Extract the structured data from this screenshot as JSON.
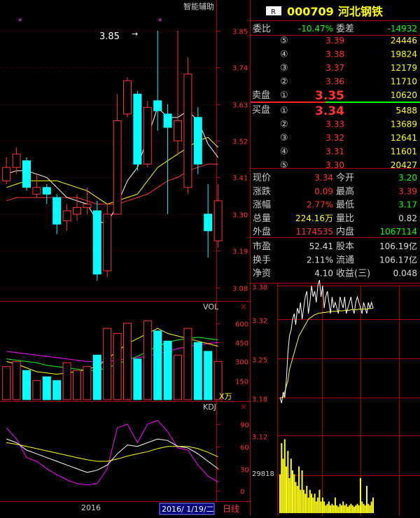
{
  "app": {
    "assist_label": "智能辅助",
    "star_marker": "*"
  },
  "stock": {
    "r_badge": "R",
    "code": "000709",
    "name": "河北钢铁"
  },
  "kline": {
    "annotation_high": "3.85",
    "price_ticks": [
      "3.85",
      "3.74",
      "3.63",
      "3.52",
      "3.41",
      "3.30",
      "3.19",
      "3.08"
    ],
    "candles": [
      {
        "o": 3.4,
        "c": 3.44,
        "h": 3.47,
        "l": 3.39
      },
      {
        "o": 3.44,
        "c": 3.48,
        "h": 3.5,
        "l": 3.42
      },
      {
        "o": 3.46,
        "c": 3.38,
        "h": 3.47,
        "l": 3.37
      },
      {
        "o": 3.36,
        "c": 3.38,
        "h": 3.42,
        "l": 3.35
      },
      {
        "o": 3.38,
        "c": 3.36,
        "h": 3.39,
        "l": 3.33
      },
      {
        "o": 3.35,
        "c": 3.27,
        "h": 3.36,
        "l": 3.24
      },
      {
        "o": 3.28,
        "c": 3.31,
        "h": 3.33,
        "l": 3.25
      },
      {
        "o": 3.3,
        "c": 3.32,
        "h": 3.36,
        "l": 3.28
      },
      {
        "o": 3.32,
        "c": 3.33,
        "h": 3.38,
        "l": 3.3
      },
      {
        "o": 3.31,
        "c": 3.12,
        "h": 3.34,
        "l": 3.1
      },
      {
        "o": 3.13,
        "c": 3.3,
        "h": 3.33,
        "l": 3.11
      },
      {
        "o": 3.3,
        "c": 3.58,
        "h": 3.66,
        "l": 3.3
      },
      {
        "o": 3.6,
        "c": 3.7,
        "h": 3.71,
        "l": 3.59
      },
      {
        "o": 3.66,
        "c": 3.45,
        "h": 3.67,
        "l": 3.43
      },
      {
        "o": 3.45,
        "c": 3.62,
        "h": 3.64,
        "l": 3.44
      },
      {
        "o": 3.64,
        "c": 3.61,
        "h": 3.85,
        "l": 3.55
      },
      {
        "o": 3.6,
        "c": 3.56,
        "h": 3.63,
        "l": 3.3
      },
      {
        "o": 3.52,
        "c": 3.58,
        "h": 3.85,
        "l": 3.48
      },
      {
        "o": 3.38,
        "c": 3.72,
        "h": 3.77,
        "l": 3.36
      },
      {
        "o": 3.59,
        "c": 3.45,
        "h": 3.62,
        "l": 3.42
      },
      {
        "o": 3.3,
        "c": 3.25,
        "h": 3.39,
        "l": 3.17
      },
      {
        "o": 3.22,
        "c": 3.34,
        "h": 3.39,
        "l": 3.2
      }
    ],
    "ma5": [
      3.42,
      3.43,
      3.43,
      3.42,
      3.41,
      3.38,
      3.35,
      3.34,
      3.33,
      3.28,
      3.27,
      3.33,
      3.4,
      3.44,
      3.53,
      3.62,
      3.59,
      3.59,
      3.61,
      3.58,
      3.51,
      3.47
    ],
    "ma10": [
      3.38,
      3.39,
      3.4,
      3.4,
      3.4,
      3.4,
      3.39,
      3.38,
      3.37,
      3.35,
      3.33,
      3.34,
      3.35,
      3.36,
      3.4,
      3.44,
      3.46,
      3.48,
      3.5,
      3.52,
      3.53,
      3.5
    ],
    "ma20": [
      3.34,
      3.35,
      3.35,
      3.35,
      3.35,
      3.35,
      3.35,
      3.35,
      3.34,
      3.33,
      3.33,
      3.33,
      3.34,
      3.35,
      3.36,
      3.38,
      3.4,
      3.41,
      3.43,
      3.44,
      3.45,
      3.45
    ],
    "colors": {
      "up": "#ff3232",
      "down": "#00ffff",
      "ma5": "#ffffff",
      "ma10": "#ffff00",
      "ma20": "#ff00ff"
    }
  },
  "vol": {
    "label": "VOL",
    "unit_label": "X万",
    "ticks": [
      "600",
      "450",
      "300",
      "150"
    ],
    "bars": [
      260,
      300,
      230,
      150,
      180,
      150,
      290,
      230,
      260,
      350,
      560,
      520,
      600,
      320,
      620,
      540,
      460,
      350,
      560,
      450,
      380,
      300
    ],
    "ma5": [
      300,
      280,
      250,
      220,
      210,
      200,
      210,
      220,
      240,
      260,
      320,
      380,
      440,
      480,
      520,
      560,
      520,
      500,
      480,
      460,
      440,
      420
    ],
    "ma10": [
      320,
      310,
      300,
      290,
      270,
      260,
      250,
      240,
      230,
      230,
      250,
      280,
      310,
      340,
      380,
      420,
      450,
      470,
      480,
      490,
      480,
      470
    ],
    "ma20": [
      380,
      370,
      360,
      350,
      340,
      330,
      320,
      310,
      300,
      300,
      300,
      310,
      320,
      330,
      340,
      360,
      380,
      400,
      420,
      430,
      440,
      450
    ]
  },
  "kdj": {
    "label": "KDJ",
    "ticks": [
      "90",
      "60",
      "30",
      "0"
    ],
    "k": [
      70,
      65,
      55,
      50,
      45,
      40,
      35,
      30,
      25,
      28,
      35,
      50,
      62,
      60,
      65,
      70,
      68,
      60,
      58,
      50,
      40,
      30
    ],
    "d": [
      65,
      63,
      60,
      57,
      54,
      51,
      48,
      45,
      42,
      40,
      40,
      43,
      47,
      50,
      53,
      57,
      60,
      60,
      60,
      57,
      52,
      46
    ],
    "j": [
      85,
      70,
      45,
      40,
      30,
      22,
      15,
      10,
      8,
      10,
      30,
      85,
      90,
      65,
      90,
      95,
      80,
      58,
      55,
      35,
      20,
      12
    ]
  },
  "timeline": {
    "year": "2016",
    "date": "2016/ 1/19/二",
    "period": "日线"
  },
  "quote": {
    "weibi_label": "委比",
    "weibi_value": "-10.47%",
    "weicha_label": "委差",
    "weicha_value": "-14932",
    "sell_label": "卖盘",
    "buy_label": "买盘",
    "sells": [
      {
        "idx": "⑤",
        "price": "3.39",
        "vol": "24446"
      },
      {
        "idx": "④",
        "price": "3.38",
        "vol": "19824"
      },
      {
        "idx": "③",
        "price": "3.37",
        "vol": "12179"
      },
      {
        "idx": "②",
        "price": "3.36",
        "vol": "11710"
      },
      {
        "idx": "①",
        "price": "3.35",
        "vol": "10620"
      }
    ],
    "buys": [
      {
        "idx": "①",
        "price": "3.34",
        "vol": "5488"
      },
      {
        "idx": "②",
        "price": "3.33",
        "vol": "13689"
      },
      {
        "idx": "③",
        "price": "3.32",
        "vol": "12641"
      },
      {
        "idx": "④",
        "price": "3.31",
        "vol": "11601"
      },
      {
        "idx": "⑤",
        "price": "3.30",
        "vol": "20427"
      }
    ],
    "stats": [
      {
        "l1": "现价",
        "v1": "3.34",
        "c1": "#ff3232",
        "l2": "今开",
        "v2": "3.20",
        "c2": "#00ff00"
      },
      {
        "l1": "涨跌",
        "v1": "0.09",
        "c1": "#ff3232",
        "l2": "最高",
        "v2": "3.39",
        "c2": "#ff3232"
      },
      {
        "l1": "涨幅",
        "v1": "2.77%",
        "c1": "#ff3232",
        "l2": "最低",
        "v2": "3.17",
        "c2": "#00ff00"
      },
      {
        "l1": "总量",
        "v1": "224.16万",
        "c1": "#ffff00",
        "l2": "量比",
        "v2": "0.82",
        "c2": "#dddddd"
      },
      {
        "l1": "外盘",
        "v1": "1174535",
        "c1": "#ff3232",
        "l2": "内盘",
        "v2": "1067114",
        "c2": "#00ff00"
      }
    ],
    "stats2": [
      {
        "l1": "市盈",
        "v1": "52.41",
        "l2": "股本",
        "v2": "106.19亿"
      },
      {
        "l1": "换手",
        "v1": "2.11%",
        "l2": "流通",
        "v2": "106.17亿"
      },
      {
        "l1": "净资",
        "v1": "4.10",
        "l2": "收益(三)",
        "v2": "0.048"
      }
    ]
  },
  "intraday": {
    "ticks": [
      "3.38",
      "3.32",
      "3.25",
      "3.18",
      "3.12"
    ],
    "vol_tick": "29818",
    "price": [
      3.18,
      3.17,
      3.19,
      3.18,
      3.21,
      3.26,
      3.29,
      3.3,
      3.32,
      3.33,
      3.31,
      3.34,
      3.33,
      3.35,
      3.32,
      3.34,
      3.36,
      3.37,
      3.33,
      3.35,
      3.38,
      3.36,
      3.37,
      3.35,
      3.38,
      3.39,
      3.36,
      3.38,
      3.34,
      3.36,
      3.37,
      3.35,
      3.33,
      3.36,
      3.34,
      3.35,
      3.34,
      3.33,
      3.36,
      3.35,
      3.34,
      3.36,
      3.33,
      3.34,
      3.35,
      3.36,
      3.34,
      3.33,
      3.35,
      3.36,
      3.35,
      3.34,
      3.33,
      3.35,
      3.34,
      3.33,
      3.35,
      3.34,
      3.35,
      3.34
    ],
    "avg": [
      3.18,
      3.18,
      3.18,
      3.19,
      3.2,
      3.21,
      3.23,
      3.24,
      3.25,
      3.26,
      3.27,
      3.28,
      3.29,
      3.295,
      3.3,
      3.305,
      3.31,
      3.315,
      3.32,
      3.322,
      3.324,
      3.326,
      3.328,
      3.329,
      3.33,
      3.331,
      3.331,
      3.332,
      3.332,
      3.332,
      3.333,
      3.333,
      3.333,
      3.334,
      3.334,
      3.334,
      3.334,
      3.335,
      3.335,
      3.335,
      3.335,
      3.336,
      3.336,
      3.336,
      3.336,
      3.337,
      3.337,
      3.337,
      3.337,
      3.337,
      3.338,
      3.338,
      3.338,
      3.338,
      3.338,
      3.338,
      3.339,
      3.339,
      3.339,
      3.34
    ],
    "vols": [
      0.5,
      0.9,
      0.7,
      0.95,
      0.6,
      0.8,
      0.45,
      0.7,
      0.55,
      0.5,
      0.4,
      0.35,
      0.6,
      0.3,
      0.55,
      0.3,
      0.25,
      0.35,
      0.2,
      0.3,
      0.25,
      0.2,
      0.25,
      0.15,
      0.2,
      0.3,
      0.15,
      0.2,
      0.15,
      0.1,
      0.12,
      0.15,
      0.1,
      0.12,
      0.1,
      0.2,
      0.1,
      0.08,
      0.12,
      0.1,
      0.15,
      0.1,
      0.12,
      0.08,
      0.1,
      0.12,
      0.1,
      0.08,
      0.1,
      0.12,
      0.1,
      0.45,
      0.15,
      0.12,
      0.1,
      0.35,
      0.12,
      0.1,
      0.15,
      0.2
    ]
  }
}
